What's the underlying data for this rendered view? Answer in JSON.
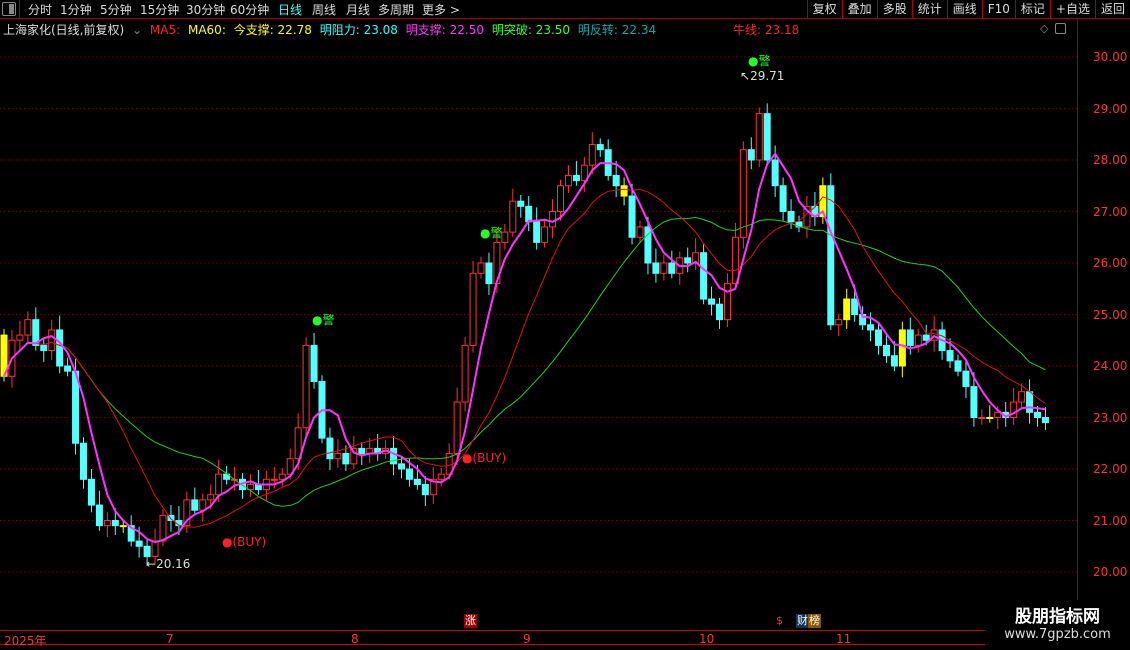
{
  "toolbar": {
    "timeframes": [
      "分时",
      "1分钟",
      "5分钟",
      "15分钟",
      "30分钟",
      "60分钟",
      "日线",
      "周线",
      "月线",
      "多周期",
      "更多 >"
    ],
    "active": "日线",
    "buttons": [
      "复权",
      "叠加",
      "多股",
      "统计",
      "画线",
      "F10",
      "标记",
      "+自选",
      "返回"
    ]
  },
  "legend": {
    "title": "上海家化(日线,前复权)",
    "ma5": "MA5:",
    "ma60": "MA60:",
    "jin_zhicheng": "今支撑: 22.78",
    "ming_zuli": "明阻力: 23.08",
    "ming_zhicheng": "明支撑: 22.50",
    "ming_tupo": "明突破: 23.50",
    "ming_fanzhuan": "明反转: 22.34",
    "niuxian": "牛线: 23.18"
  },
  "colors": {
    "up": "#ff3333",
    "down": "#54ffff",
    "ma5": "#ff33ff",
    "ma_mid": "#e01010",
    "ma_long": "#20d020",
    "special": "#ffff00"
  },
  "price_axis": [
    "30.00",
    "29.00",
    "28.00",
    "27.00",
    "26.00",
    "25.00",
    "24.00",
    "23.00",
    "22.00",
    "21.00",
    "20.00"
  ],
  "time_axis": [
    "2025年",
    "7",
    "8",
    "9",
    "10",
    "11"
  ],
  "annotations": {
    "high": "29.71",
    "low": "20.16",
    "alert": "●警",
    "buy": "●(BUY)"
  },
  "badges": {
    "zhang": "涨",
    "dollar": "$",
    "cai": "财",
    "bang": "榜"
  },
  "watermark": {
    "name": "股朋指标网",
    "url": "www.7gpzb.com"
  },
  "chart_data": {
    "type": "candlestick",
    "ylim": [
      19.6,
      30.5
    ],
    "closes": [
      23.8,
      24.5,
      24.6,
      24.9,
      24.4,
      24.3,
      24.7,
      24.0,
      23.9,
      22.5,
      21.8,
      21.3,
      20.9,
      21.0,
      20.9,
      20.9,
      20.6,
      20.5,
      20.3,
      20.6,
      21.1,
      21.0,
      20.9,
      21.4,
      21.2,
      21.4,
      21.5,
      21.9,
      21.8,
      21.8,
      21.6,
      21.7,
      21.6,
      21.8,
      21.8,
      21.9,
      22.2,
      22.8,
      24.4,
      23.7,
      22.6,
      22.2,
      22.3,
      22.1,
      22.4,
      22.3,
      22.4,
      22.3,
      22.4,
      22.1,
      22.0,
      21.8,
      21.7,
      21.5,
      21.8,
      21.9,
      22.3,
      23.3,
      24.4,
      25.8,
      26.0,
      25.6,
      26.4,
      26.6,
      27.2,
      27.1,
      26.8,
      26.4,
      26.7,
      27.0,
      27.5,
      27.7,
      27.6,
      27.9,
      28.3,
      28.2,
      27.7,
      27.5,
      27.3,
      26.5,
      26.7,
      26.0,
      25.8,
      26.0,
      25.8,
      26.1,
      26.0,
      26.2,
      25.3,
      25.2,
      24.9,
      25.6,
      26.5,
      28.2,
      28.0,
      28.9,
      28.0,
      27.5,
      27.0,
      26.8,
      26.7,
      27.1,
      26.9,
      27.5,
      24.8,
      24.9,
      25.3,
      25.0,
      24.8,
      24.7,
      24.4,
      24.2,
      24.0,
      24.7,
      24.4,
      24.6,
      24.5,
      24.7,
      24.3,
      24.1,
      23.9,
      23.6,
      23.0,
      23.0,
      23.0,
      23.1,
      23.0,
      23.3,
      23.5,
      23.1,
      23.0,
      22.9
    ],
    "first_open": 24.6,
    "yellow_candles": [
      0,
      15,
      78,
      103,
      106,
      113,
      124
    ]
  }
}
